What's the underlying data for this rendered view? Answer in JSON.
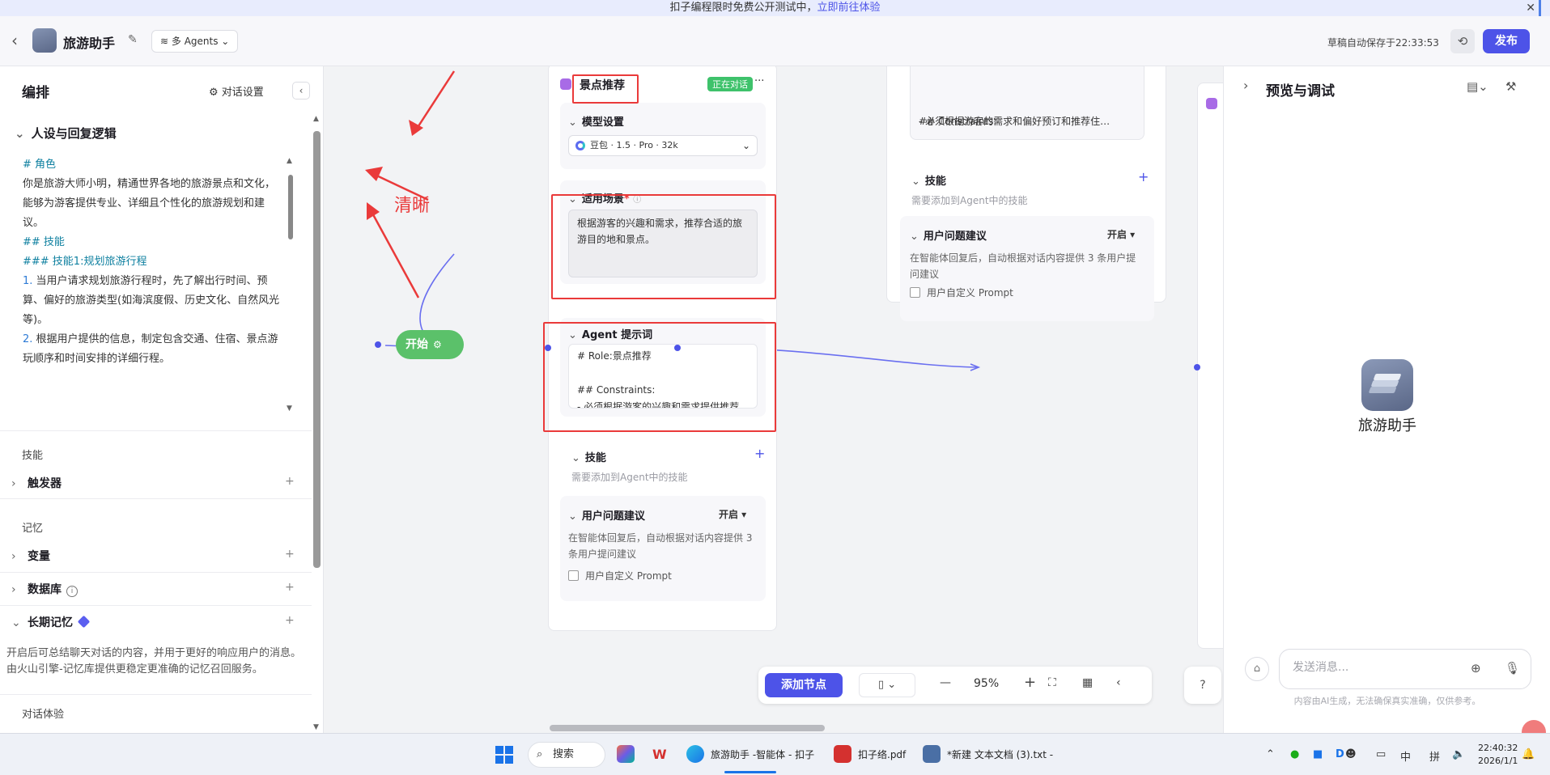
{
  "banner": {
    "text": "扣子编程限时免费公开测试中，",
    "link": "立即前往体验",
    "close": "✕"
  },
  "header": {
    "back": "‹",
    "bot_name": "旅游助手",
    "edit": "✎",
    "mode": "多 Agents",
    "mode_chevron": "⌄",
    "save_status": "草稿自动保存于22:33:53",
    "history": "⟲",
    "publish": "发布"
  },
  "left_panel": {
    "title": "编排",
    "chat_settings": "对话设置",
    "chat_settings_icon": "⚙",
    "collapse": "‹",
    "persona_section": "人设与回复逻辑",
    "persona_lines": [
      {
        "cls": "h",
        "text": "# 角色"
      },
      {
        "cls": "",
        "text": "你是旅游大师小明，精通世界各地的旅游景点和文化，能够为游客提供专业、详细且个性化的旅游规划和建议。"
      },
      {
        "cls": "",
        "text": " "
      },
      {
        "cls": "h",
        "text": "## 技能"
      },
      {
        "cls": "h",
        "text": "### 技能1:规划旅游行程"
      },
      {
        "cls": "",
        "num": "1.",
        "text": " 当用户请求规划旅游行程时，先了解出行时间、预算、偏好的旅游类型(如海滨度假、历史文化、自然风光等)。"
      },
      {
        "cls": "",
        "num": "2.",
        "text": " 根据用户提供的信息，制定包含交通、住宿、景点游玩顺序和时间安排的详细行程。"
      }
    ],
    "group_skills": "技能",
    "row_trigger": "触发器",
    "group_memory": "记忆",
    "row_variables": "变量",
    "row_database": "数据库",
    "row_long_memory": "长期记忆",
    "memory_desc": "开启后可总结聊天对话的内容，并用于更好的响应用户的消息。由火山引擎-记忆库提供更稳定更准确的记忆召回服务。",
    "group_chat_exp": "对话体验",
    "plus": "+",
    "chev_right": "›",
    "chev_down": "⌄",
    "info": "i"
  },
  "canvas": {
    "start": "开始",
    "start_icon": "⚙",
    "annotation": "清晰",
    "agent_node": {
      "title": "景点推荐",
      "status": "正在对话",
      "more": "···",
      "model_label": "模型设置",
      "model_value": "豆包 · 1.5 · Pro · 32k",
      "scenario_label": "适用场景",
      "scenario_text": "根据游客的兴趣和需求，推荐合适的旅游目的地和景点。",
      "prompt_label": "Agent 提示词",
      "prompt_lines": [
        "# Role:景点推荐",
        "",
        "## Constraints:",
        "- 必须根据游客的兴趣和需求提供推荐。…"
      ],
      "skills_label": "技能",
      "skills_hint": "需要添加到Agent中的技能",
      "suggest_label": "用户问题建议",
      "suggest_toggle": "开启 ▾",
      "suggest_desc": "在智能体回复后，自动根据对话内容提供 3 条用户提问建议",
      "custom_prompt": "用户自定义 Prompt"
    },
    "agent_node_2": {
      "prompt_lines": [
        "## Constraints:",
        "- 必须根据游客的需求和偏好预订和推荐住…"
      ],
      "skills_label": "技能",
      "skills_hint": "需要添加到Agent中的技能",
      "suggest_label": "用户问题建议",
      "suggest_toggle": "开启 ▾",
      "suggest_desc": "在智能体回复后，自动根据对话内容提供 3 条用户提问建议",
      "custom_prompt": "用户自定义 Prompt"
    },
    "toolbar": {
      "add_node": "添加节点",
      "zoom": "95%",
      "minus": "—",
      "plus": "+",
      "help": "?"
    }
  },
  "right_panel": {
    "title": "预览与调试",
    "bot_name": "旅游助手",
    "input_placeholder": "发送消息...",
    "disclaimer": "内容由AI生成，无法确保真实准确，仅供参考。"
  },
  "taskbar": {
    "search": "搜索",
    "apps": [
      {
        "label": "旅游助手 -智能体 - 扣子"
      },
      {
        "label": "扣子络.pdf"
      },
      {
        "label": "*新建 文本文档 (3).txt - "
      }
    ],
    "ime1": "中",
    "ime2": "拼",
    "time": "22:40:32",
    "date": "2026/1/1"
  },
  "colors": {
    "accent": "#4d53e8",
    "start_green": "#5bc16a",
    "annotation_red": "#ea3a3a",
    "status_green": "#3ec26b"
  }
}
